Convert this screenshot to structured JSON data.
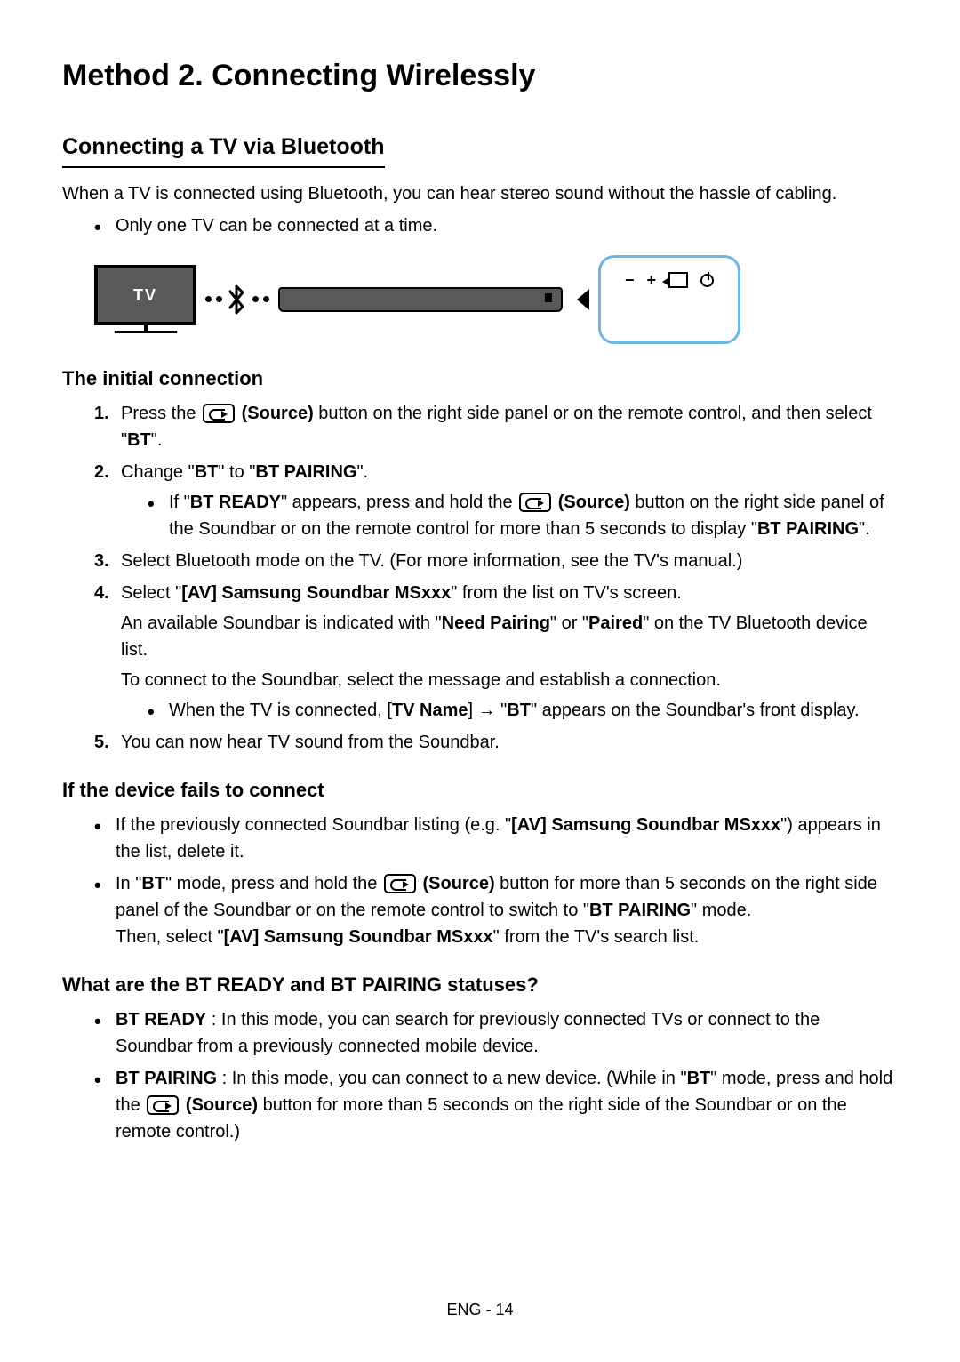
{
  "title": "Method 2. Connecting Wirelessly",
  "subtitle": "Connecting a TV via Bluetooth",
  "intro": "When a TV is connected using Bluetooth, you can hear stereo sound without the hassle of cabling.",
  "introBullet": "Only one TV can be connected at a time.",
  "diagram": {
    "tvLabel": "TV",
    "panelMinus": "−",
    "panelPlus": "+"
  },
  "h3_initial": "The initial connection",
  "steps": {
    "s1a": "Press the ",
    "s1b": " (Source)",
    "s1c": " button on the right side panel or on the remote control, and then select \"",
    "s1d": "BT",
    "s1e": "\".",
    "s2a": "Change \"",
    "s2b": "BT",
    "s2c": "\" to \"",
    "s2d": "BT PAIRING",
    "s2e": "\".",
    "s2sub_a": "If \"",
    "s2sub_b": "BT READY",
    "s2sub_c": "\" appears, press and hold the ",
    "s2sub_d": " (Source)",
    "s2sub_e": " button on the right side panel of the Soundbar or on the remote control for more than 5 seconds to display \"",
    "s2sub_f": "BT PAIRING",
    "s2sub_g": "\".",
    "s3": "Select Bluetooth mode on the TV. (For more information, see the TV's manual.)",
    "s4a": "Select \"",
    "s4b": "[AV] Samsung Soundbar MSxxx",
    "s4c": "\" from the list on TV's screen.",
    "s4line2a": "An available Soundbar is indicated with \"",
    "s4line2b": "Need Pairing",
    "s4line2c": "\" or \"",
    "s4line2d": "Paired",
    "s4line2e": "\" on the TV Bluetooth device list.",
    "s4line3": "To connect to the Soundbar, select the message and establish a connection.",
    "s4sub_a": "When the TV is connected, [",
    "s4sub_b": "TV Name",
    "s4sub_c": "] → \"",
    "s4sub_d": "BT",
    "s4sub_e": "\" appears on the Soundbar's front display.",
    "s5": "You can now hear TV sound from the Soundbar."
  },
  "h3_fail": "If the device fails to connect",
  "fail": {
    "b1a": "If the previously connected Soundbar listing (e.g. \"",
    "b1b": "[AV] Samsung Soundbar MSxxx",
    "b1c": "\") appears in the list, delete it.",
    "b2a": "In \"",
    "b2b": "BT",
    "b2c": "\" mode, press and hold the ",
    "b2d": " (Source)",
    "b2e": " button for more than 5 seconds on the right side panel of the Soundbar or on the remote control to switch to \"",
    "b2f": "BT PAIRING",
    "b2g": "\" mode.",
    "b2line2a": "Then, select \"",
    "b2line2b": "[AV] Samsung Soundbar MSxxx",
    "b2line2c": "\" from the TV's search list."
  },
  "h3_status": "What are the BT READY and BT PAIRING statuses?",
  "status": {
    "r1a": "BT READY",
    "r1b": " : In this mode, you can search for previously connected TVs or connect to the Soundbar from a previously connected mobile device.",
    "r2a": "BT PAIRING",
    "r2b": " : In this mode, you can connect to a new device. (While in \"",
    "r2c": "BT",
    "r2d": "\" mode, press and hold the ",
    "r2e": " (Source)",
    "r2f": " button for more than 5 seconds on the right side of the Soundbar or on the remote control.)"
  },
  "footer": "ENG - 14"
}
